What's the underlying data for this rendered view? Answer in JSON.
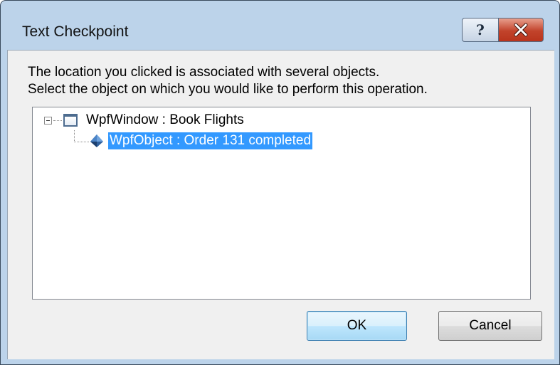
{
  "dialog": {
    "title": "Text Checkpoint",
    "help_icon": "question-mark-icon",
    "close_icon": "close-x-icon",
    "message_line1": "The location you clicked is associated with several objects.",
    "message_line2": "Select the object on which you would like to perform this operation."
  },
  "tree": {
    "root": {
      "label": "WpfWindow : Book Flights",
      "icon": "window-icon",
      "expanded": true
    },
    "children": [
      {
        "label": "WpfObject : Order 131 completed",
        "icon": "wpf-object-icon",
        "selected": true
      }
    ]
  },
  "buttons": {
    "ok_label": "OK",
    "cancel_label": "Cancel"
  },
  "colors": {
    "selection": "#3399ff",
    "close_button": "#c2432b",
    "dialog_background": "#f0f0f0"
  }
}
